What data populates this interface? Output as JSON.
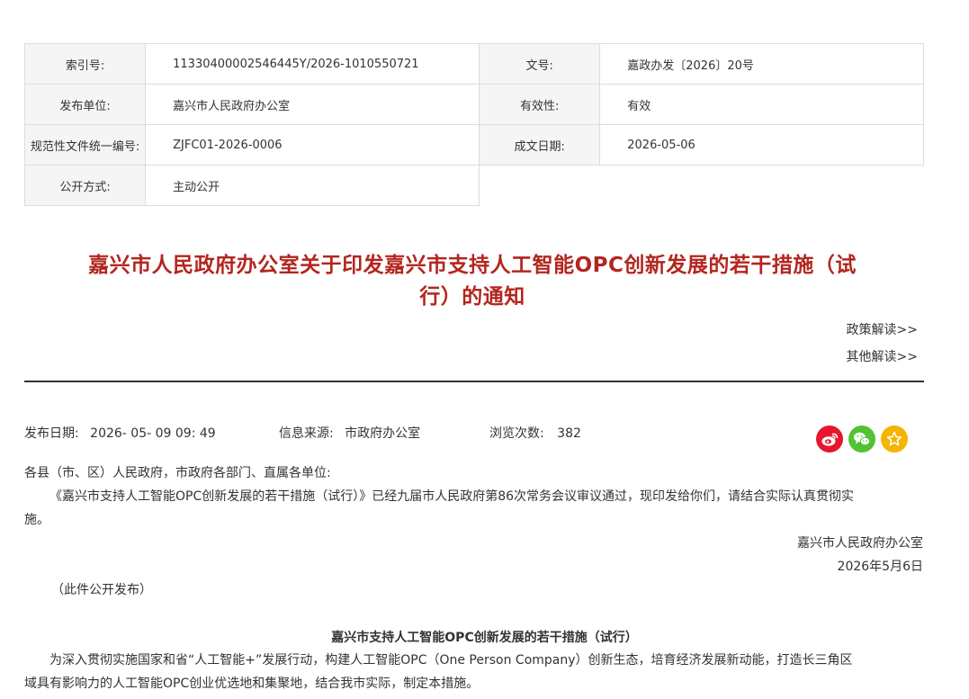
{
  "meta": {
    "index_label": "索引号:",
    "index_value": "11330400002546445Y/2026-1010550721",
    "docno_label": "文号:",
    "docno_value": "嘉政办发〔2026〕20号",
    "issuer_label": "发布单位:",
    "issuer_value": "嘉兴市人民政府办公室",
    "validity_label": "有效性:",
    "validity_value": "有效",
    "code_label": "规范性文件统一编号:",
    "code_value": "ZJFC01-2026-0006",
    "date_label": "成文日期:",
    "date_value": "2026-05-06",
    "public_label": "公开方式:",
    "public_value": "主动公开"
  },
  "title": {
    "line1": "嘉兴市人民政府办公室关于印发嘉兴市支持人工智能OPC创新发展的若干措施（试",
    "line2": "行）的通知"
  },
  "links": {
    "policy": "政策解读>>",
    "other": "其他解读>>"
  },
  "info": {
    "publish_label": "发布日期:",
    "publish_value": "2026- 05- 09 09: 49",
    "source_label": "信息来源:",
    "source_value": "市政府办公室",
    "views_label": "浏览次数:",
    "views_value": "382"
  },
  "share": {
    "weibo_icon": "weibo-icon",
    "wechat_icon": "wechat-icon",
    "favorite_icon": "star-icon",
    "weibo_color": "#e6162d",
    "wechat_color": "#51c332",
    "favorite_color": "#f4b400"
  },
  "content": {
    "salutation": "各县（市、区）人民政府，市政府各部门、直属各单位:",
    "para1_line1": "《嘉兴市支持人工智能OPC创新发展的若干措施（试行）》已经九届市人民政府第86次常务会议审议通过，现印发给你们，请结合实际认真贯彻实",
    "para1_line2": "施。",
    "signature": "嘉兴市人民政府办公室",
    "sign_date": "2026年5月6日",
    "publish_note": "（此件公开发布）",
    "subtitle": "嘉兴市支持人工智能OPC创新发展的若干措施（试行）",
    "para2_line1": "为深入贯彻实施国家和省“人工智能+”发展行动，构建人工智能OPC（One Person Company）创新生态，培育经济发展新动能，打造长三角区",
    "para2_line2": "域具有影响力的人工智能OPC创业优选地和集聚地，结合我市实际，制定本措施。"
  }
}
